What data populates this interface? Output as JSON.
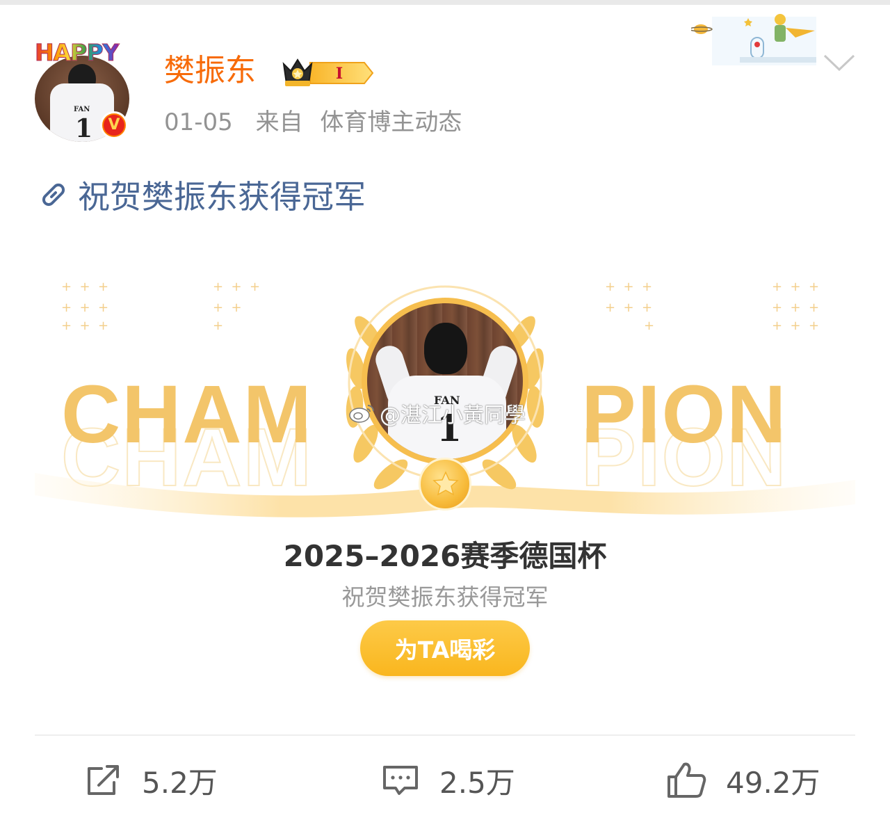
{
  "post": {
    "avatar_decoration": "HAPPY",
    "username": "樊振东",
    "level_badge": "I",
    "date": "01-05",
    "source_prefix": "来自",
    "source": "体育博主动态",
    "topic": "祝贺樊振东获得冠军"
  },
  "card": {
    "word_left": "CHAM",
    "word_right": "PION",
    "jersey_name": "FAN",
    "jersey_number": "1",
    "watermark": "@湛江小黃同學",
    "title": "2025–2026赛季德国杯",
    "subtitle": "祝贺樊振东获得冠军",
    "cheer_button": "为TA喝彩"
  },
  "actions": {
    "repost_count": "5.2万",
    "comment_count": "2.5万",
    "like_count": "49.2万"
  },
  "colors": {
    "username": "#f76b0a",
    "topic_link": "#4a6795",
    "champion_gold": "#f3c56a",
    "button": "#f9b61e",
    "meta_gray": "#939393"
  },
  "icons": [
    "verified-v-icon",
    "crown-level-icon",
    "chevron-down-icon",
    "link-icon",
    "laurel-wreath-icon",
    "star-medal-icon",
    "weibo-logo-icon",
    "repost-icon",
    "comment-icon",
    "like-icon"
  ]
}
